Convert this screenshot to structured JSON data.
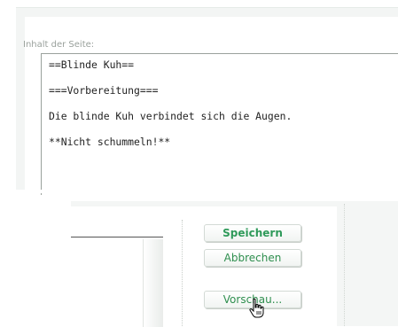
{
  "form": {
    "content_label": "Inhalt der Seite:",
    "content_lines": [
      "==Blinde Kuh==",
      "===Vorbereitung===",
      "Die blinde Kuh verbindet sich die Augen.",
      "**Nicht schummeln!**"
    ]
  },
  "actions": {
    "save_label": "Speichern",
    "cancel_label": "Abbrechen",
    "preview_label": "Vorschau..."
  },
  "colors": {
    "accent_green": "#2f9a5a",
    "panel_bg": "#f3f5f4"
  },
  "icons": {
    "cursor": "hand-pointer-icon"
  }
}
